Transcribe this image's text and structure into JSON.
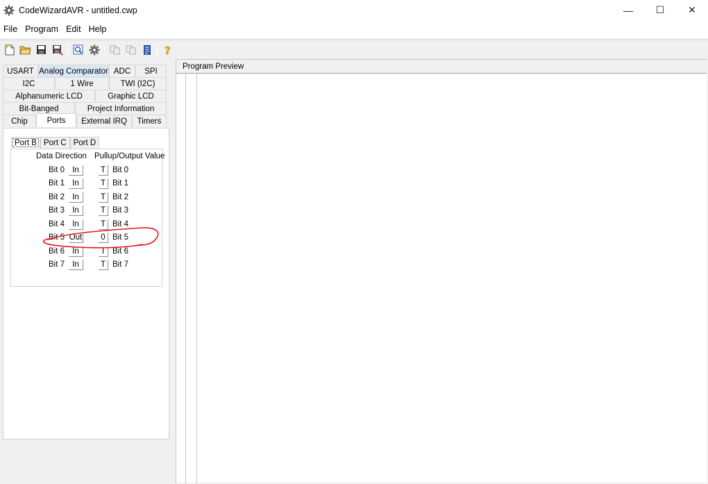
{
  "window": {
    "title": "CodeWizardAVR - untitled.cwp",
    "controls": {
      "minimize": "—",
      "maximize": "☐",
      "close": "✕"
    }
  },
  "menu": [
    {
      "label": "File"
    },
    {
      "label": "Program"
    },
    {
      "label": "Edit"
    },
    {
      "label": "Help"
    }
  ],
  "toolbar": {
    "icons": [
      "new-file-icon",
      "open-folder-icon",
      "save-icon",
      "save-as-icon",
      "preview-icon",
      "generate-gear-icon",
      "copy-icon",
      "paste-icon",
      "document-icon",
      "help-icon"
    ]
  },
  "tabs": {
    "row1": [
      "USART",
      "Analog Comparator",
      "ADC",
      "SPI"
    ],
    "row2": [
      "I2C",
      "1 Wire",
      "TWI (I2C)"
    ],
    "row3": [
      "Alphanumeric LCD",
      "Graphic LCD"
    ],
    "row4": [
      "Bit-Banged",
      "Project Information"
    ],
    "row5": [
      "Chip",
      "Ports",
      "External IRQ",
      "Timers"
    ],
    "active": "Ports"
  },
  "port_tabs": [
    "Port B",
    "Port C",
    "Port D"
  ],
  "headers": {
    "data_direction": "Data Direction",
    "pullup": "Pullup/Output Value"
  },
  "bits": [
    {
      "label": "Bit 0",
      "dir": "In",
      "value": "T",
      "label2": "Bit 0"
    },
    {
      "label": "Bit 1",
      "dir": "In",
      "value": "T",
      "label2": "Bit 1"
    },
    {
      "label": "Bit 2",
      "dir": "In",
      "value": "T",
      "label2": "Bit 2"
    },
    {
      "label": "Bit 3",
      "dir": "In",
      "value": "T",
      "label2": "Bit 3"
    },
    {
      "label": "Bit 4",
      "dir": "In",
      "value": "T",
      "label2": "Bit 4"
    },
    {
      "label": "Bit 5",
      "dir": "Out",
      "value": "0",
      "label2": "Bit 5"
    },
    {
      "label": "Bit 6",
      "dir": "In",
      "value": "T",
      "label2": "Bit 6"
    },
    {
      "label": "Bit 7",
      "dir": "In",
      "value": "T",
      "label2": "Bit 7"
    }
  ],
  "preview": {
    "title": "Program Preview"
  },
  "colors": {
    "annotation": "#e8131b",
    "tab_highlight": "#d9e8f7"
  }
}
